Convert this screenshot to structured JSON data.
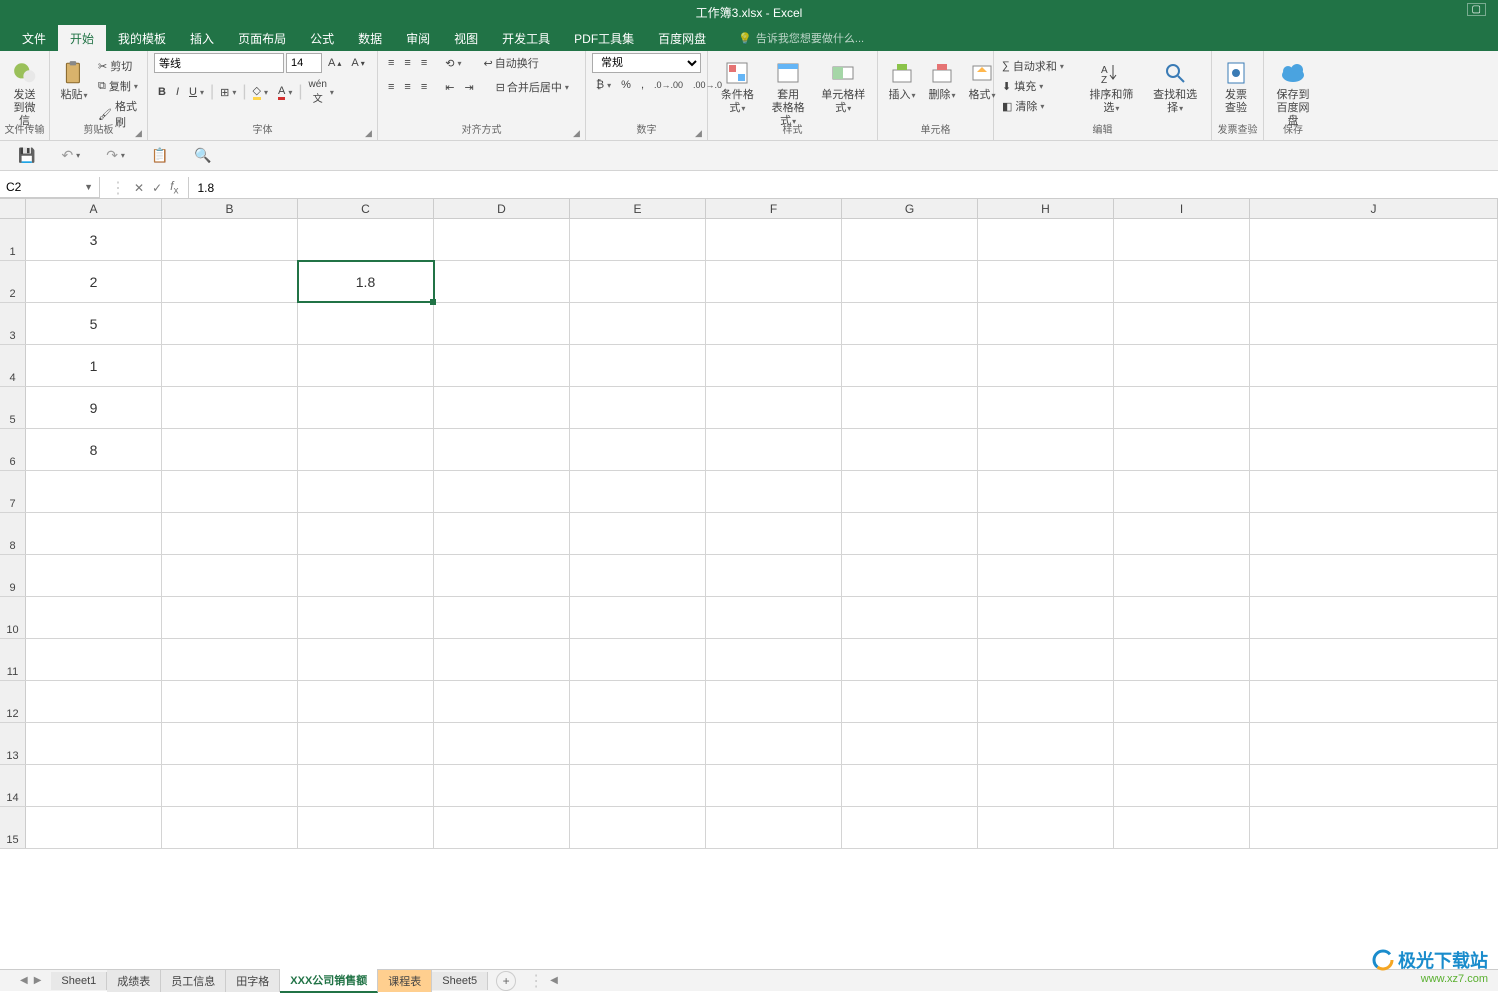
{
  "title": "工作簿3.xlsx - Excel",
  "menus": [
    "文件",
    "开始",
    "我的模板",
    "插入",
    "页面布局",
    "公式",
    "数据",
    "审阅",
    "视图",
    "开发工具",
    "PDF工具集",
    "百度网盘"
  ],
  "activeMenu": 1,
  "tellMe": "告诉我您想要做什么...",
  "groups": {
    "fileTransfer": "文件传输",
    "sendWechat": "发送\n到微信",
    "clipboard": "剪贴板",
    "paste": "粘贴",
    "cut": "剪切",
    "copy": "复制",
    "formatPainter": "格式刷",
    "font": "字体",
    "fontName": "等线",
    "fontSize": "14",
    "alignment": "对齐方式",
    "wrapText": "自动换行",
    "mergeCenter": "合并后居中",
    "number": "数字",
    "numberFormat": "常规",
    "styles": "样式",
    "condFormat": "条件格式",
    "tableFormat": "套用\n表格格式",
    "cellStyles": "单元格样式",
    "cells": "单元格",
    "insert": "插入",
    "delete": "删除",
    "format": "格式",
    "editing": "编辑",
    "autoSum": "自动求和",
    "fill": "填充",
    "clear": "清除",
    "sortFilter": "排序和筛选",
    "findSelect": "查找和选择",
    "invoice": "发票查验",
    "invoiceBtn": "发票\n查验",
    "save": "保存",
    "saveBaidu": "保存到\n百度网盘"
  },
  "nameBox": "C2",
  "formula": "1.8",
  "columns": [
    "A",
    "B",
    "C",
    "D",
    "E",
    "F",
    "G",
    "H",
    "I",
    "J"
  ],
  "rows": [
    {
      "n": "1",
      "A": "3"
    },
    {
      "n": "2",
      "A": "2",
      "C": "1.8"
    },
    {
      "n": "3",
      "A": "5"
    },
    {
      "n": "4",
      "A": "1"
    },
    {
      "n": "5",
      "A": "9"
    },
    {
      "n": "6",
      "A": "8"
    },
    {
      "n": "7"
    },
    {
      "n": "8"
    },
    {
      "n": "9"
    },
    {
      "n": "10"
    },
    {
      "n": "11"
    },
    {
      "n": "12"
    },
    {
      "n": "13"
    },
    {
      "n": "14"
    },
    {
      "n": "15"
    }
  ],
  "selectedCell": {
    "row": 1,
    "col": "C"
  },
  "sheetTabs": [
    "Sheet1",
    "成绩表",
    "员工信息",
    "田字格",
    "XXX公司销售额",
    "课程表",
    "Sheet5"
  ],
  "activeSheetTab": 5,
  "watermark": {
    "l1": "极光下载站",
    "l2": "www.xz7.com"
  }
}
